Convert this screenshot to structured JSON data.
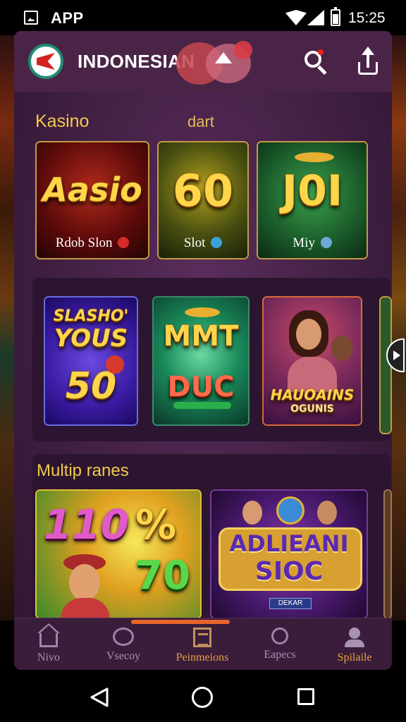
{
  "status_bar": {
    "app_name": "APP",
    "time": "15:25",
    "icons": [
      "image-icon",
      "wifi-icon",
      "signal-icon",
      "battery-icon"
    ]
  },
  "header": {
    "title": "INDONESIAN",
    "logo": "red-arrow-logo",
    "actions": [
      "search-icon",
      "share-icon"
    ]
  },
  "sections": {
    "kasino_label": "Kasino",
    "dart_label": "dart",
    "multiplayer_label": "Multip ranes"
  },
  "row1": [
    {
      "title": "Aasio",
      "caption": "Rdob Slon",
      "badge_color": "#d62b2b"
    },
    {
      "title": "60",
      "caption": "Slot",
      "badge_color": "#3aa0d8"
    },
    {
      "title": "J0I",
      "caption": "Miy",
      "badge_color": "#6fa8d8"
    }
  ],
  "row2": [
    {
      "line1": "SLASHO'",
      "line2": "YOUS",
      "line3": "50"
    },
    {
      "line1": "MMT",
      "line2": "DUC"
    },
    {
      "line1": "HAUOAINS",
      "line2": "OGUNIS"
    }
  ],
  "row3": [
    {
      "line1": "110",
      "line2": "%",
      "line3": "70"
    },
    {
      "line1": "ADLIEANI",
      "line2": "SIOC",
      "line3": "DEKAR"
    }
  ],
  "bottom_nav": [
    {
      "label": "Nivo",
      "icon": "home-icon",
      "active": false
    },
    {
      "label": "Vsecoy",
      "icon": "chat-icon",
      "active": false
    },
    {
      "label": "Peinmeions",
      "icon": "document-icon",
      "active": true
    },
    {
      "label": "Eapecs",
      "icon": "search-person-icon",
      "active": false
    },
    {
      "label": "Spilaile",
      "icon": "profile-icon",
      "active": false
    }
  ],
  "colors": {
    "panel": "#3d1f3f",
    "accent_gold": "#f2c94c",
    "nav_active": "#e6a040",
    "nav_indicator": "#e8642a"
  }
}
